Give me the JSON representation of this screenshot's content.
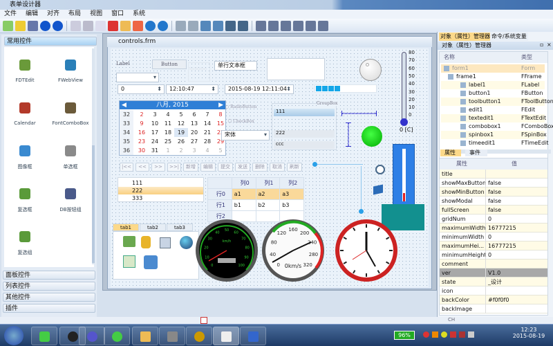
{
  "window": {
    "title": "表单设计器"
  },
  "menu": [
    "文件",
    "编辑",
    "对齐",
    "布局",
    "视图",
    "窗口",
    "系统"
  ],
  "palette": {
    "header": "常用控件",
    "items": [
      {
        "label": "FDTEdit",
        "icon": "datetime-icon",
        "color": "#6a9a3a"
      },
      {
        "label": "FWebView",
        "icon": "globe-icon",
        "color": "#2a7fb8"
      },
      {
        "label": "Calendar",
        "icon": "calendar-icon",
        "color": "#b33a2a"
      },
      {
        "label": "FontComboBox",
        "icon": "font-icon",
        "color": "#6b5a3a"
      },
      {
        "label": "图像框",
        "icon": "image-icon",
        "color": "#3a8ad0"
      },
      {
        "label": "单选框",
        "icon": "radio-icon",
        "color": "#8a8a8a"
      },
      {
        "label": "复选框",
        "icon": "checkbox-icon",
        "color": "#5a9a3a"
      },
      {
        "label": "DB按钮组",
        "icon": "button-group-icon",
        "color": "#4a5a8a"
      },
      {
        "label": "复选组",
        "icon": "checkbox-group-icon",
        "color": "#5a9a3a"
      }
    ],
    "categories": [
      "面板控件",
      "列表控件",
      "其他控件",
      "插件"
    ]
  },
  "form": {
    "title": "controls.frm",
    "label": "Label",
    "button": "Button",
    "disabled_button": "ToolButton",
    "lineedit": "单行文本框",
    "spin": "0",
    "time": "12:10:47",
    "datetime": "2015-08-19 12:11:04",
    "progress_segments": 4,
    "calendar": {
      "header": "八月, 2015",
      "weeks": [
        32,
        33,
        34,
        35,
        36
      ],
      "days": [
        [
          2,
          3,
          4,
          5,
          6,
          7,
          8
        ],
        [
          9,
          10,
          11,
          12,
          13,
          14,
          15
        ],
        [
          16,
          17,
          18,
          19,
          20,
          21,
          22
        ],
        [
          23,
          24,
          25,
          26,
          27,
          28,
          29
        ],
        [
          30,
          31,
          1,
          2,
          3,
          4,
          5
        ]
      ],
      "selected": 19
    },
    "radio": "RadioButton",
    "checkbox": "CheckBox",
    "font": "宋体",
    "groupbox": {
      "title": "GroupBox",
      "items": [
        "111",
        "222",
        "ccc"
      ]
    },
    "thermometer": {
      "ticks": [
        "80",
        "70",
        "60",
        "50",
        "40",
        "30",
        "20",
        "10",
        "0"
      ],
      "readout": "0 [C]",
      "value": 0
    },
    "nav": [
      "|<<",
      "<<",
      ">>",
      ">>|",
      "新增",
      "编辑",
      "提交",
      "发送",
      "删除",
      "取消",
      "刷新"
    ],
    "list": [
      "111",
      "222",
      "333"
    ],
    "list_selected": 1,
    "table": {
      "columns": [
        "列0",
        "列1",
        "列2"
      ],
      "rows": [
        {
          "h": "行0",
          "c": [
            "a1",
            "a2",
            "a3"
          ]
        },
        {
          "h": "行1",
          "c": [
            "b1",
            "b2",
            "b3"
          ]
        },
        {
          "h": "行2",
          "c": [
            "",
            "",
            ""
          ]
        }
      ]
    },
    "tabs": [
      "tab1",
      "tab2",
      "tab3"
    ],
    "gauge1": {
      "unit": "km/h",
      "ticks": [
        "0",
        "10",
        "20",
        "30",
        "40",
        "50",
        "60",
        "70",
        "80",
        "90",
        "100"
      ]
    },
    "gauge2": {
      "unit": "0km/s",
      "ticks": [
        "0",
        "40",
        "80",
        "120",
        "160",
        "200",
        "240",
        "280",
        "320"
      ]
    }
  },
  "object_manager": {
    "tabs": [
      "对象（属性）管理器",
      "命令/系统变量"
    ],
    "title": "对象（属性）管理器",
    "columns": [
      "名称",
      "类型"
    ],
    "rows": [
      [
        "form1",
        "Form"
      ],
      [
        "frame1",
        "FFrame"
      ],
      [
        "label1",
        "FLabel"
      ],
      [
        "button1",
        "FButton"
      ],
      [
        "toolbutton1",
        "FToolButton"
      ],
      [
        "edit1",
        "FEdit"
      ],
      [
        "textedit1",
        "FTextEdit"
      ],
      [
        "combobox1",
        "FComboBox"
      ],
      [
        "spinbox1",
        "FSpinBox"
      ],
      [
        "timeedit1",
        "FTimeEdit"
      ]
    ]
  },
  "properties": {
    "tabs": [
      "属性",
      "事件"
    ],
    "columns": [
      "属性",
      "值"
    ],
    "rows": [
      [
        "title",
        ""
      ],
      [
        "showMaxButton",
        "false"
      ],
      [
        "showMinButton",
        "false"
      ],
      [
        "showModal",
        "false"
      ],
      [
        "fullScreen",
        "false"
      ],
      [
        "gridNum",
        "0"
      ],
      [
        "maximumWidth",
        "16777215"
      ],
      [
        "minimumWidth",
        "0"
      ],
      [
        "maximumHei...",
        "16777215"
      ],
      [
        "minimumHeight",
        "0"
      ],
      [
        "comment",
        ""
      ],
      [
        "ver",
        "V1.0"
      ],
      [
        "state",
        "_设计"
      ],
      [
        "icon",
        ""
      ],
      [
        "backColor",
        "#f0f0f0"
      ],
      [
        "backImage",
        ""
      ]
    ],
    "selected": 11
  },
  "tray": {
    "input": "CH",
    "battery": "96%",
    "time": "12:23",
    "date": "2015-08-19"
  }
}
